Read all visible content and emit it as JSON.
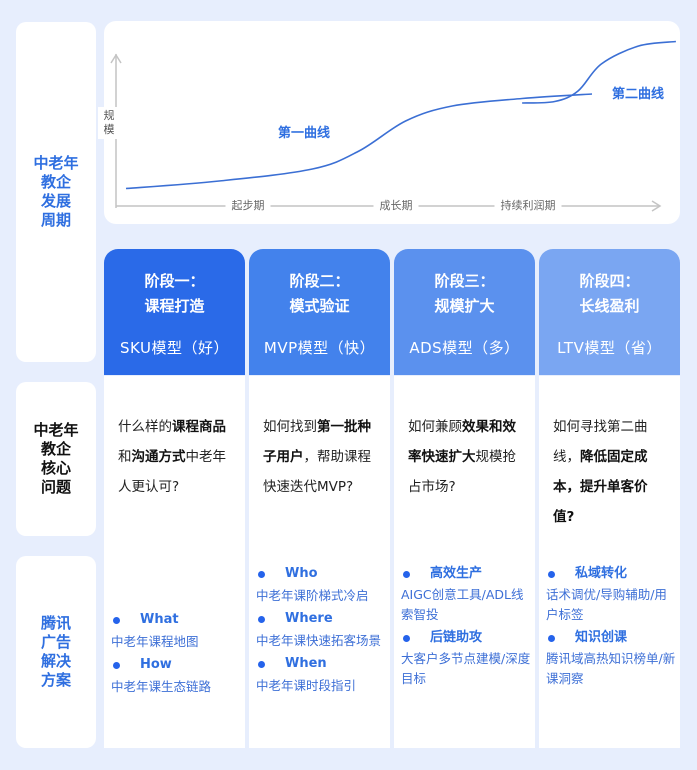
{
  "row_labels": {
    "cycle": [
      "中老年",
      "教企",
      "发展",
      "周期"
    ],
    "issues": [
      "中老年",
      "教企",
      "核心",
      "问题"
    ],
    "solutions": [
      "腾讯",
      "广告",
      "解决",
      "方案"
    ]
  },
  "chart_data": {
    "type": "line",
    "title": "",
    "ylabel": "规模",
    "xlabel": "",
    "x_phases": [
      "起步期",
      "成长期",
      "持续利润期"
    ],
    "series": [
      {
        "name": "第一曲线",
        "x": [
          0.0,
          0.2,
          0.4,
          0.5,
          0.6,
          0.7,
          0.85,
          1.0
        ],
        "y": [
          0.05,
          0.1,
          0.18,
          0.3,
          0.5,
          0.6,
          0.65,
          0.68
        ]
      },
      {
        "name": "第二曲线",
        "x": [
          0.85,
          0.92,
          0.97,
          1.02,
          1.1,
          1.18
        ],
        "y": [
          0.62,
          0.63,
          0.7,
          0.88,
          1.0,
          1.03
        ]
      }
    ],
    "grid": false,
    "color": "#3b6fd4"
  },
  "columns": [
    {
      "title1": "阶段一：",
      "title2": "课程打造",
      "model": "SKU模型（好）",
      "color": "#2a6ae8",
      "question": [
        {
          "t": "什么样的",
          "b": false
        },
        {
          "t": "课程商品",
          "b": true
        },
        {
          "t": "和",
          "b": false
        },
        {
          "t": "沟通方式",
          "b": true
        },
        {
          "t": "中老年人更认可?",
          "b": false
        }
      ],
      "solutions": [
        {
          "title": "What",
          "desc": "中老年课程地图"
        },
        {
          "title": "How",
          "desc": "中老年课生态链路"
        }
      ]
    },
    {
      "title1": "阶段二：",
      "title2": "模式验证",
      "model": "MVP模型（快）",
      "color": "#4382ec",
      "question": [
        {
          "t": "如何找到",
          "b": false
        },
        {
          "t": "第一批种子用户",
          "b": true
        },
        {
          "t": "，帮助课程快速迭代MVP?",
          "b": false
        }
      ],
      "solutions": [
        {
          "title": "Who",
          "desc": "中老年课阶梯式冷启"
        },
        {
          "title": "Where",
          "desc": "中老年课快速拓客场景"
        },
        {
          "title": "When",
          "desc": "中老年课时段指引"
        }
      ]
    },
    {
      "title1": "阶段三：",
      "title2": "规模扩大",
      "model": "ADS模型（多）",
      "color": "#5b91ee",
      "question": [
        {
          "t": "如何兼顾",
          "b": false
        },
        {
          "t": "效果和效率快速扩大",
          "b": true
        },
        {
          "t": "规模抢占市场?",
          "b": false
        }
      ],
      "solutions": [
        {
          "title": "高效生产",
          "desc": "AIGC创意工具/ADL线索智投"
        },
        {
          "title": "后链助攻",
          "desc": "大客户多节点建模/深度目标"
        }
      ]
    },
    {
      "title1": "阶段四：",
      "title2": "长线盈利",
      "model": "LTV模型（省）",
      "color": "#7aa6f2",
      "question": [
        {
          "t": "如何寻找第二曲线，",
          "b": false
        },
        {
          "t": "降低固定成本，提升单客价值?",
          "b": true
        }
      ],
      "solutions": [
        {
          "title": "私域转化",
          "desc": "话术调优/导购辅助/用户标签"
        },
        {
          "title": "知识创课",
          "desc": "腾讯域高热知识榜单/新课洞察"
        }
      ]
    }
  ]
}
